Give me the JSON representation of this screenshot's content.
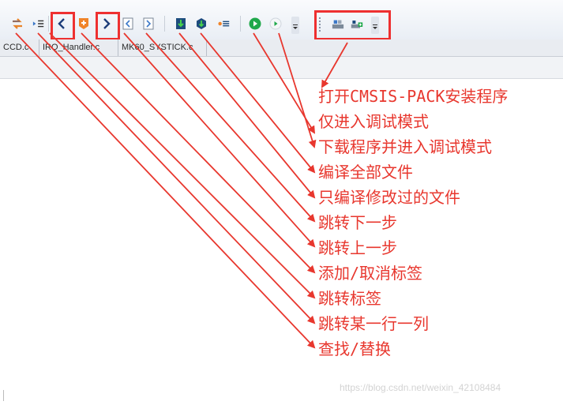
{
  "toolbar": {
    "icons": [
      "find-replace-icon",
      "goto-line-icon",
      "nav-back-icon",
      "bookmark-toggle-icon",
      "nav-forward-icon",
      "prev-bookmark-icon",
      "next-bookmark-icon",
      "build-icon",
      "compile-icon",
      "stop-build-icon",
      "start-debug-icon",
      "run-icon",
      "pack-installer-icon",
      "pack-manage-icon"
    ]
  },
  "tabs": [
    "CCD.c",
    "IRQ_Handler.c",
    "MK60_SYSTICK.c"
  ],
  "annotations": [
    "打开CMSIS-PACK安装程序",
    "仅进入调试模式",
    "下载程序并进入调试模式",
    "编译全部文件",
    "只编译修改过的文件",
    "跳转下一步",
    "跳转上一步",
    "添加/取消标签",
    "跳转标签",
    "跳转某一行一列",
    "查找/替换"
  ],
  "watermark": "https://blog.csdn.net/weixin_42108484",
  "colors": {
    "annotation": "#e8372e",
    "highlight_box": "#ee3030",
    "toolbar_bg": "#eef2f7"
  }
}
